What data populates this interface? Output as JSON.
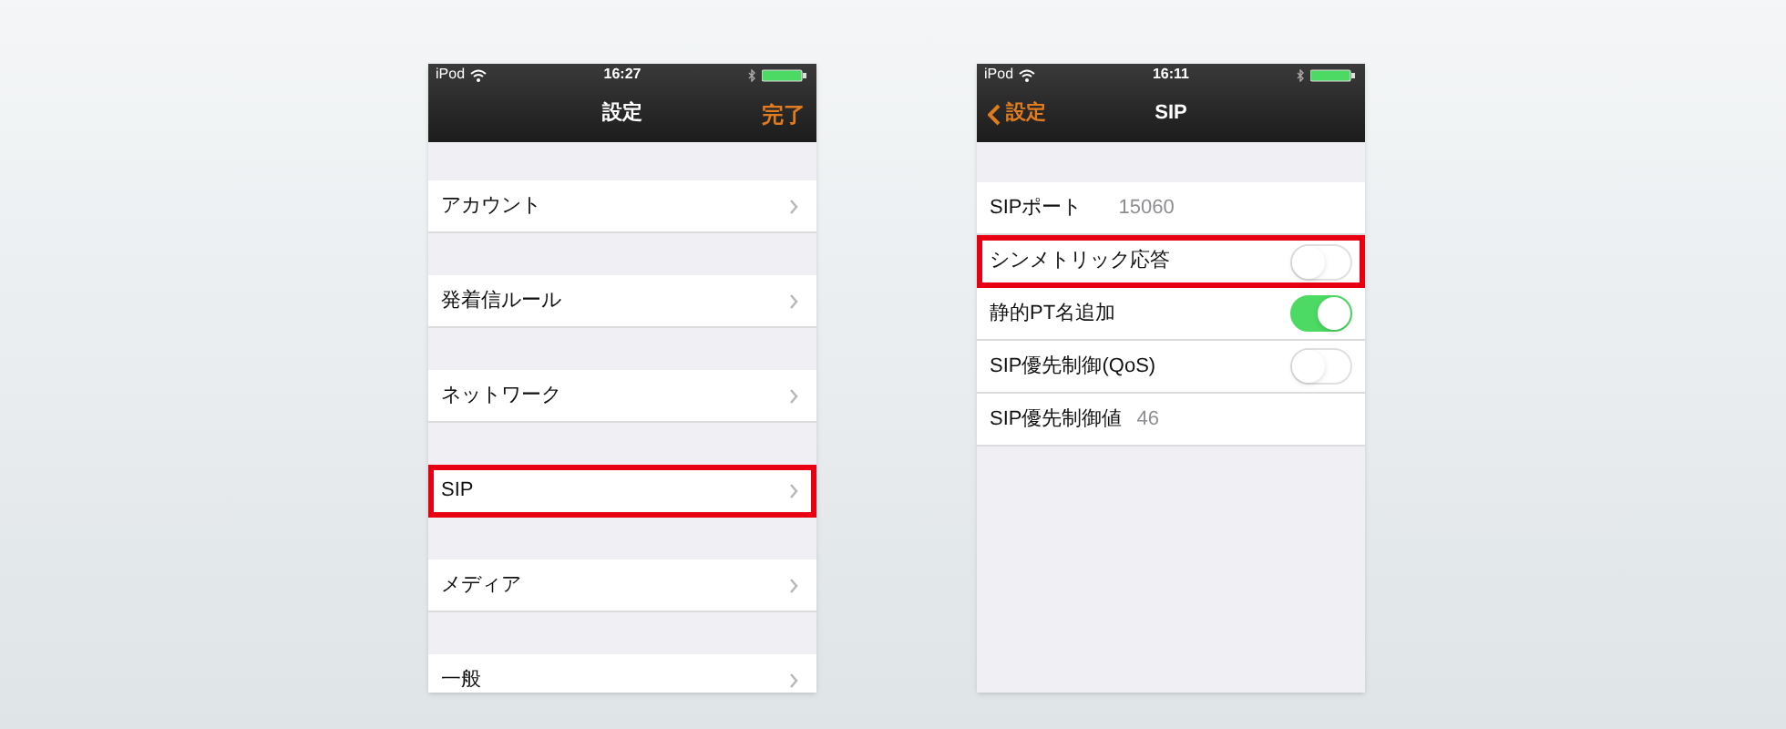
{
  "screens": [
    {
      "status_bar": {
        "device": "iPod",
        "time": "16:27"
      },
      "nav": {
        "title": "設定",
        "done": "完了"
      },
      "rows": [
        {
          "kind": "link",
          "label": "アカウント",
          "highlighted": false
        },
        {
          "kind": "link",
          "label": "発着信ルール",
          "highlighted": false
        },
        {
          "kind": "link",
          "label": "ネットワーク",
          "highlighted": false
        },
        {
          "kind": "link",
          "label": "SIP",
          "highlighted": true
        },
        {
          "kind": "link",
          "label": "メディア",
          "highlighted": false
        },
        {
          "kind": "link",
          "label": "一般",
          "highlighted": false
        }
      ]
    },
    {
      "status_bar": {
        "device": "iPod",
        "time": "16:11"
      },
      "nav": {
        "title": "SIP",
        "back": "設定"
      },
      "rows": [
        {
          "kind": "value",
          "label": "SIPポート",
          "value": "15060",
          "highlighted": false
        },
        {
          "kind": "switch",
          "label": "シンメトリック応答",
          "on": false,
          "highlighted": true
        },
        {
          "kind": "switch",
          "label": "静的PT名追加",
          "on": true,
          "highlighted": false
        },
        {
          "kind": "switch",
          "label": "SIP優先制御(QoS)",
          "on": false,
          "highlighted": false
        },
        {
          "kind": "value",
          "label": "SIP優先制御値",
          "value": "46",
          "highlighted": false
        }
      ]
    }
  ]
}
